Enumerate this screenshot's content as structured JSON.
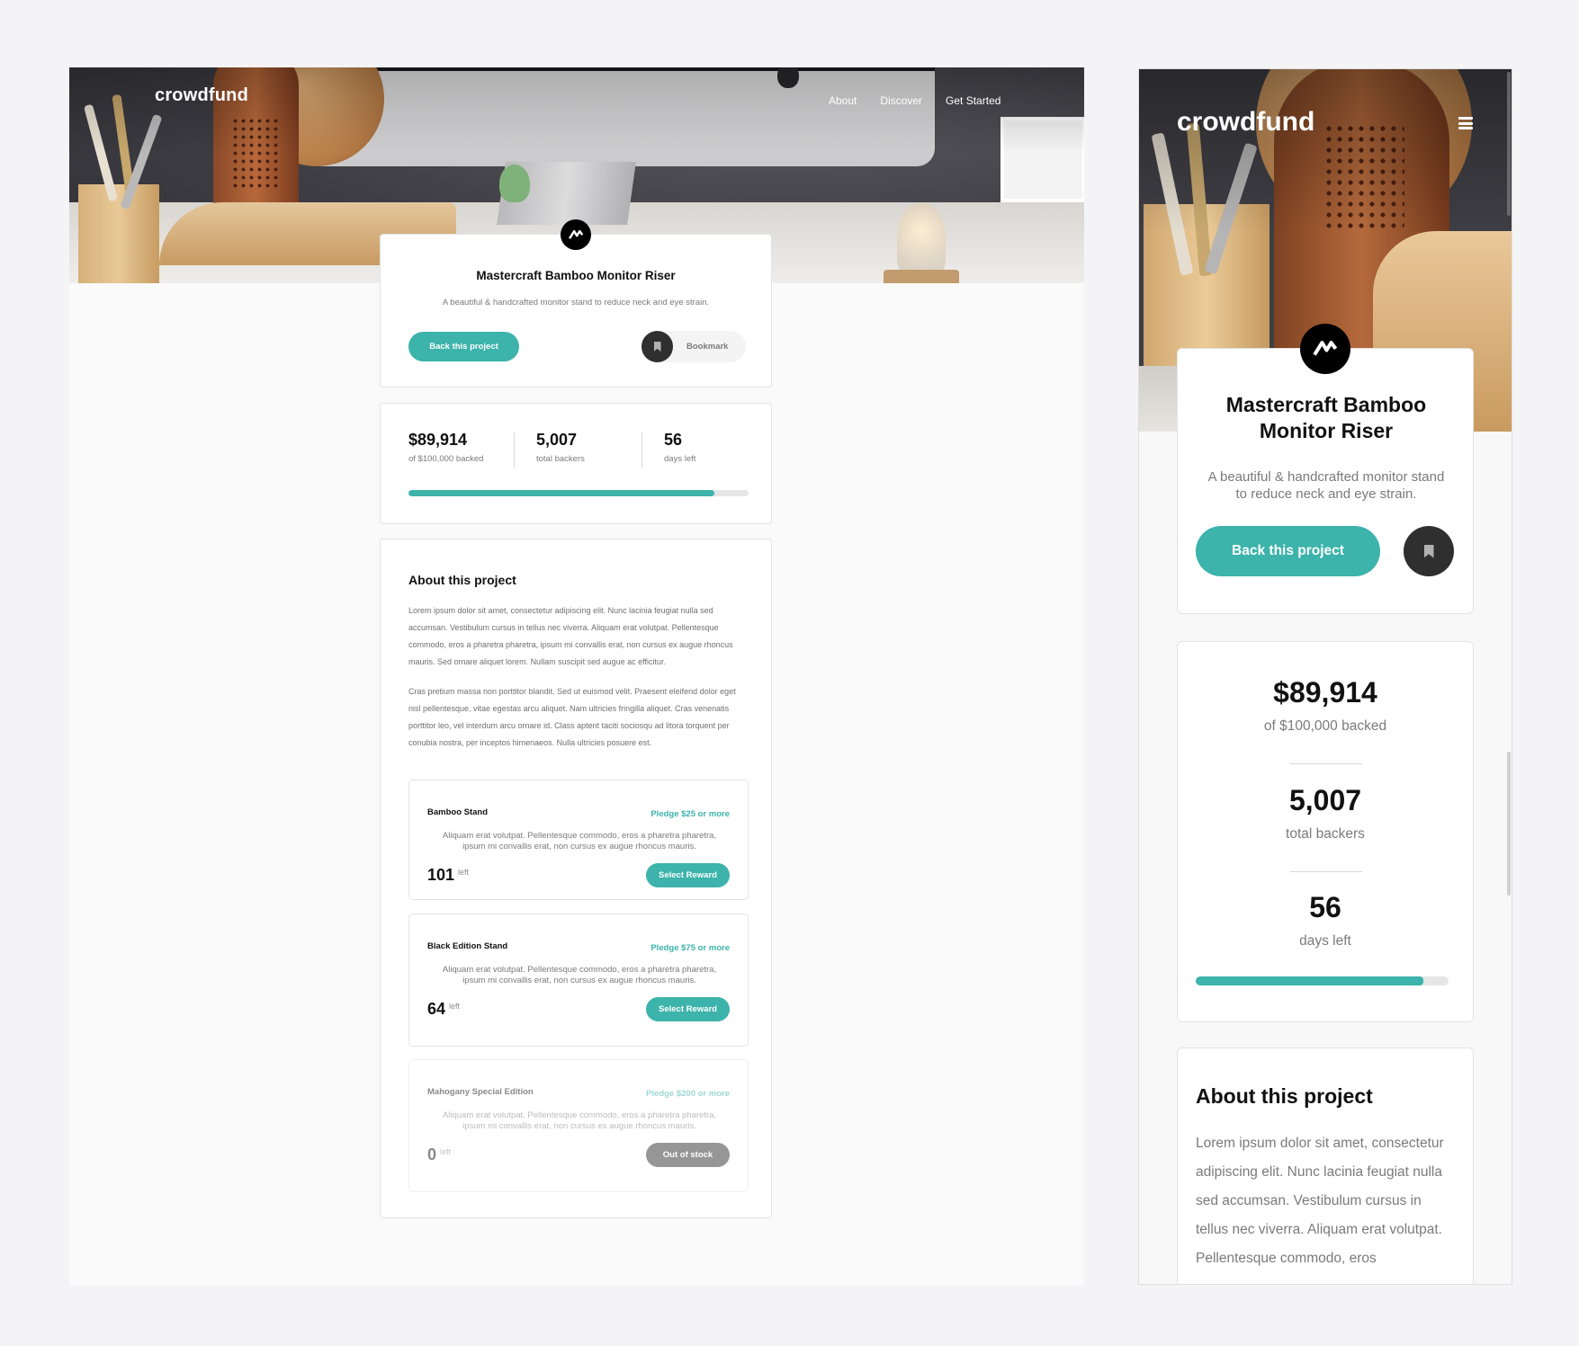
{
  "brand": {
    "logo": "crowdfund"
  },
  "nav": {
    "items": [
      "About",
      "Discover",
      "Get Started"
    ]
  },
  "project": {
    "title": "Mastercraft Bamboo Monitor Riser",
    "description": "A beautiful & handcrafted monitor stand to reduce neck and eye strain.",
    "back_label": "Back this project",
    "bookmark_label": "Bookmark"
  },
  "stats": {
    "backed": "$89,914",
    "backed_label": "of $100,000 backed",
    "backers": "5,007",
    "backers_label": "total backers",
    "days": "56",
    "days_label": "days left",
    "progress_fraction": 0.899
  },
  "about": {
    "heading": "About this project",
    "paragraph1": "Lorem ipsum dolor sit amet, consectetur adipiscing elit. Nunc lacinia feugiat nulla sed accumsan. Vestibulum cursus in tellus nec viverra. Aliquam erat volutpat. Pellentesque commodo, eros a pharetra pharetra, ipsum mi convallis erat, non cursus ex augue rhoncus mauris. Sed ornare aliquet lorem. Nullam suscipit sed augue ac efficitur.",
    "paragraph2": "Cras pretium massa non porttitor blandit. Sed ut euismod velit. Praesent eleifend dolor eget nisl pellentesque, vitae egestas arcu aliquet. Nam ultricies fringilla aliquet. Cras venenatis porttitor leo, vel interdum arcu ornare id. Class aptent taciti sociosqu ad litora torquent per conubia nostra, per inceptos himenaeos. Nulla ultricies posuere est.",
    "mobile_paragraph": "Lorem ipsum dolor sit amet, consectetur adipiscing elit. Nunc lacinia feugiat nulla sed accumsan. Vestibulum cursus in tellus nec viverra. Aliquam erat volutpat. Pellentesque commodo, eros"
  },
  "rewards": [
    {
      "name": "Bamboo Stand",
      "pledge": "Pledge $25 or more",
      "description": "Aliquam erat volutpat. Pellentesque commodo, eros a pharetra pharetra, ipsum mi convallis erat, non cursus ex augue rhoncus mauris.",
      "count": "101",
      "left_label": "left",
      "button": "Select Reward"
    },
    {
      "name": "Black Edition Stand",
      "pledge": "Pledge $75 or more",
      "description": "Aliquam erat volutpat. Pellentesque commodo, eros a pharetra pharetra, ipsum mi convallis erat, non cursus ex augue rhoncus mauris.",
      "count": "64",
      "left_label": "left",
      "button": "Select Reward"
    },
    {
      "name": "Mahogany Special Edition",
      "pledge": "Pledge $200 or more",
      "description": "Aliquam erat volutpat. Pellentesque commodo, eros a pharetra pharetra, ipsum mi convallis erat, non cursus ex augue rhoncus mauris.",
      "count": "0",
      "left_label": "left",
      "button": "Out of stock"
    }
  ],
  "colors": {
    "accent": "#3cb3ab",
    "dark": "#2f2f2f",
    "text": "#111111",
    "muted": "#7a7a7a"
  },
  "icons": {
    "brand": "mastercraft-logo-icon",
    "bookmark": "bookmark-icon",
    "menu": "hamburger-menu-icon"
  }
}
